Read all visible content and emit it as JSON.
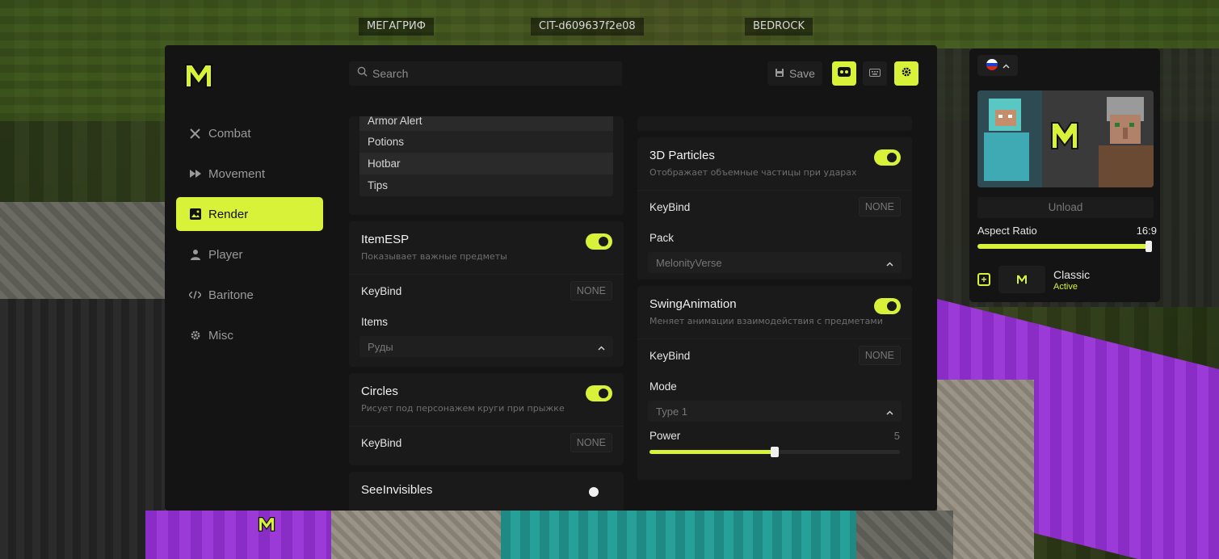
{
  "scene": {
    "nametags": [
      "МЕГАГРИФ",
      "CIT-d609637f2e08",
      "BEDROCK"
    ]
  },
  "header": {
    "search": {
      "placeholder": "Search"
    },
    "save_label": "Save",
    "icons": [
      "user-icon",
      "keyboard-icon",
      "gear-icon"
    ]
  },
  "sidebar": {
    "items": [
      {
        "label": "Combat",
        "icon": "swords-icon",
        "active": false
      },
      {
        "label": "Movement",
        "icon": "fast-forward-icon",
        "active": false
      },
      {
        "label": "Render",
        "icon": "image-icon",
        "active": true
      },
      {
        "label": "Player",
        "icon": "person-icon",
        "active": false
      },
      {
        "label": "Baritone",
        "icon": "code-icon",
        "active": false
      },
      {
        "label": "Misc",
        "icon": "gear-icon",
        "active": false
      }
    ]
  },
  "left_column": {
    "list": [
      "Armor Alert",
      "Potions",
      "Hotbar",
      "Tips"
    ],
    "itemesp": {
      "title": "ItemESP",
      "desc": "Показывает важные предметы",
      "enabled": true,
      "keybind_label": "KeyBind",
      "keybind_value": "NONE",
      "items_label": "Items",
      "items_value": "Руды"
    },
    "circles": {
      "title": "Circles",
      "desc": "Рисует под персонажем круги при прыжке",
      "enabled": true,
      "keybind_label": "KeyBind",
      "keybind_value": "NONE"
    },
    "seeinvisibles": {
      "title": "SeeInvisibles",
      "enabled": false
    }
  },
  "right_column": {
    "particles": {
      "title": "3D Particles",
      "desc": "Отображает объемные частицы при ударах",
      "enabled": true,
      "keybind_label": "KeyBind",
      "keybind_value": "NONE",
      "pack_label": "Pack",
      "pack_value": "MelonityVerse"
    },
    "swing": {
      "title": "SwingAnimation",
      "desc": "Меняет анимации взаимодействия с предметами",
      "enabled": true,
      "keybind_label": "KeyBind",
      "keybind_value": "NONE",
      "mode_label": "Mode",
      "mode_value": "Type 1",
      "power_label": "Power",
      "power_value": "5",
      "power_fraction": 0.5
    }
  },
  "right_panel": {
    "language": "ru-flag",
    "unload_label": "Unload",
    "aspect_label": "Aspect Ratio",
    "aspect_value": "16:9",
    "aspect_fraction": 1.0,
    "profile_name": "Classic",
    "profile_status": "Active"
  },
  "colors": {
    "accent": "#d8f23a",
    "panel": "#141414",
    "card": "#1a1a1a"
  }
}
